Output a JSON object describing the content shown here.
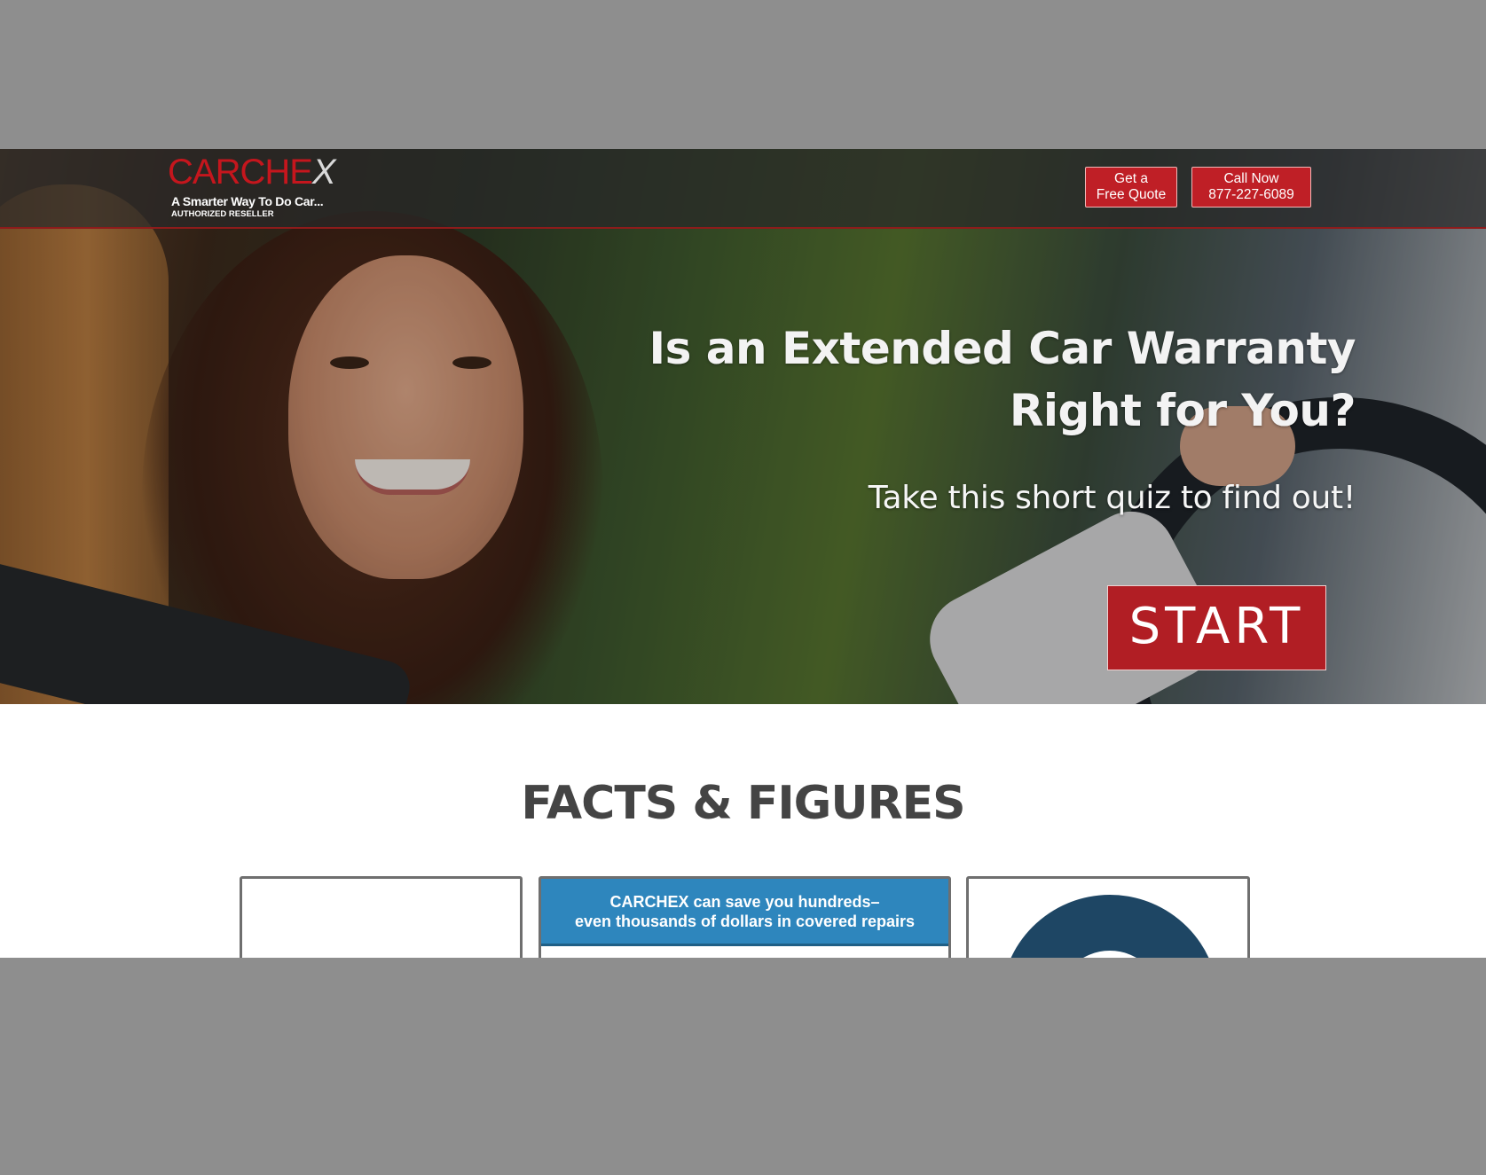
{
  "brand": {
    "logo_main": "CARCHE",
    "logo_x": "X",
    "tagline": "A Smarter Way To Do Car...",
    "subtag": "AUTHORIZED RESELLER",
    "accent": "#c5161d"
  },
  "nav": {
    "quote_line1": "Get a",
    "quote_line2": "Free Quote",
    "call_line1": "Call Now",
    "call_line2": "877-227-6089"
  },
  "hero": {
    "title_line1": "Is an Extended Car Warranty",
    "title_line2": "Right for You?",
    "subtitle": "Take this short quiz to find out!",
    "start_label": "START"
  },
  "facts": {
    "heading": "FACTS & FIGURES",
    "center_banner_line1": "CARCHEX can save you hundreds–",
    "center_banner_line2": "even thousands of dollars in covered repairs",
    "banner_color": "#2e86bd",
    "pie_colors": [
      "#1e4664",
      "#dadada"
    ]
  }
}
